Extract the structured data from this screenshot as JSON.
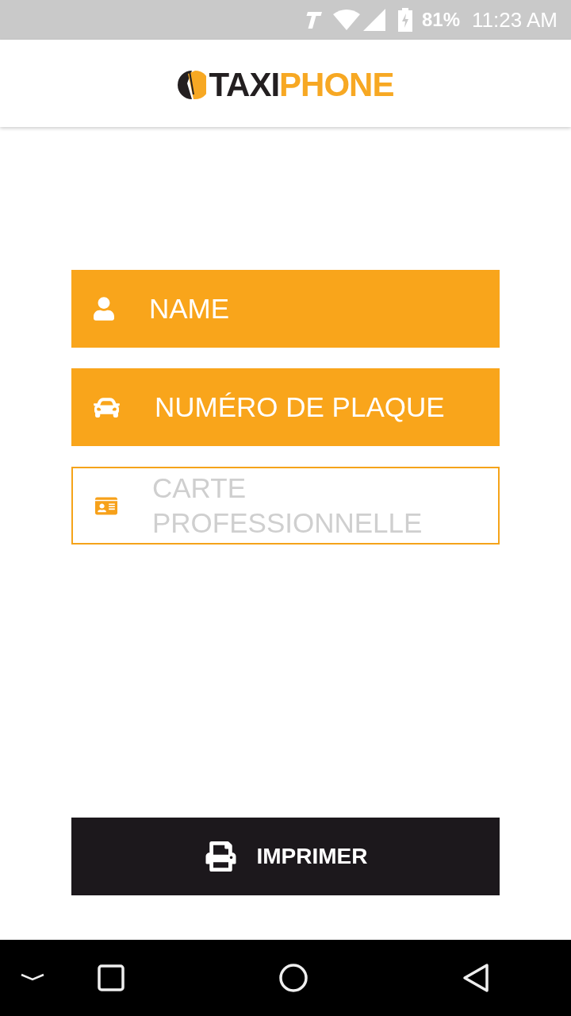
{
  "status_bar": {
    "battery_percent": "81%",
    "time": "11:23 AM"
  },
  "header": {
    "logo": [
      {
        "text": "TAXI",
        "kind": "dark"
      },
      {
        "text": "PHONE",
        "kind": "accent"
      }
    ]
  },
  "fields": [
    {
      "kind": "person",
      "placeholder": "NAME",
      "highlighted": true
    },
    {
      "kind": "car",
      "placeholder": "NUMÉRO DE PLAQUE",
      "highlighted": true
    },
    {
      "kind": "id-card",
      "placeholder": "CARTE PROFESSIONNELLE",
      "highlighted": false
    }
  ],
  "print_button": {
    "label": "IMPRIMER"
  }
}
